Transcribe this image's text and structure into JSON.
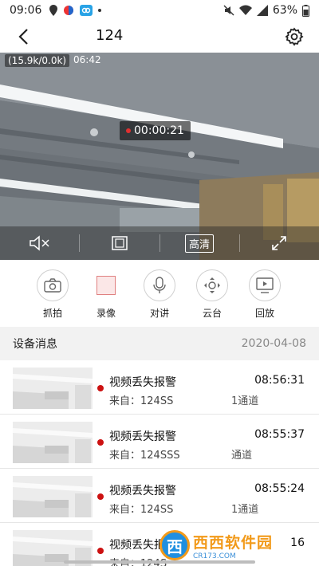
{
  "status_bar": {
    "time": "09:06",
    "battery": "63%",
    "icons": [
      "location-icon",
      "app-icon",
      "cloud-icon",
      "mute-icon",
      "wifi-icon",
      "signal-icon",
      "battery-icon"
    ]
  },
  "header": {
    "title": "124",
    "back_icon": "back-icon",
    "settings_icon": "gear-icon"
  },
  "video": {
    "speed_text": "(15.9k/0.0k)",
    "osd_clock": "06:42",
    "rec_timer": "00:00:21",
    "hd_label": "高清",
    "controls": [
      "mute-icon",
      "window-icon",
      "fullscreen-icon"
    ]
  },
  "actions": [
    {
      "label": "抓拍",
      "icon": "camera-icon"
    },
    {
      "label": "录像",
      "icon": "record-icon"
    },
    {
      "label": "对讲",
      "icon": "microphone-icon"
    },
    {
      "label": "云台",
      "icon": "ptz-icon"
    },
    {
      "label": "回放",
      "icon": "playback-icon"
    }
  ],
  "messages": {
    "title": "设备消息",
    "date": "2020-04-08",
    "items": [
      {
        "title": "视频丢失报警",
        "time": "08:56:31",
        "from": "来自：124SS",
        "channel": "1通道"
      },
      {
        "title": "视频丢失报警",
        "time": "08:55:37",
        "from": "来自：124SSS",
        "channel": "通道"
      },
      {
        "title": "视频丢失报警",
        "time": "08:55:24",
        "from": "来自：124SS",
        "channel": "1通道"
      },
      {
        "title": "视频丢失报警",
        "time": "16",
        "from": "来自：124S",
        "channel": ""
      }
    ]
  },
  "watermark": {
    "logo_char": "西",
    "name": "西西软件园",
    "url": "CR173.COM"
  },
  "colors": {
    "alarm_dot": "#cc1111",
    "rec_dot": "#e03030",
    "section_bg": "#f2f2f2"
  }
}
